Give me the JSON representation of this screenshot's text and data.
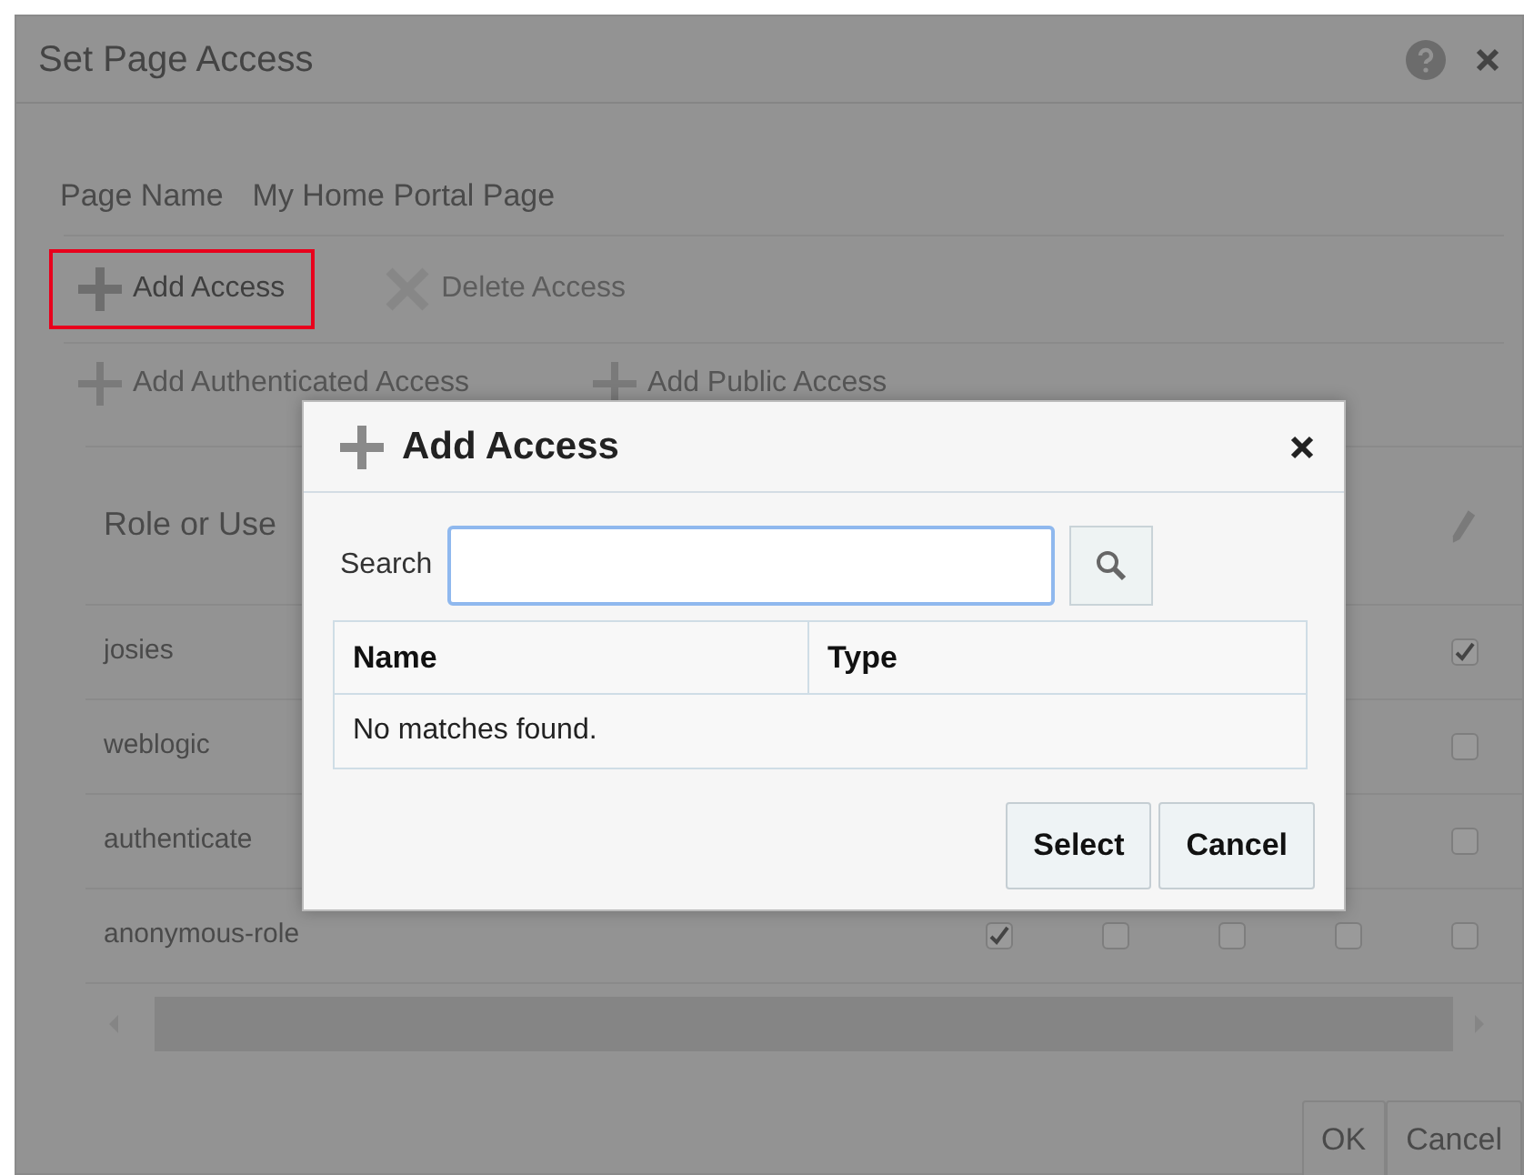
{
  "window": {
    "title": "Set Page Access"
  },
  "page_name": {
    "label": "Page Name",
    "value": "My Home Portal Page"
  },
  "toolbar": [
    {
      "label": "Add Access",
      "kind": "add",
      "disabled": false,
      "highlighted": true
    },
    {
      "label": "Delete Access",
      "kind": "delete",
      "disabled": true,
      "highlighted": false
    }
  ],
  "toolbar_2": [
    {
      "label": "Add Authenticated Access",
      "disabled": true
    },
    {
      "label": "Add Public Access",
      "disabled": true
    }
  ],
  "table": {
    "column_1": "Role or Use",
    "rows": [
      {
        "name": "josies",
        "checks": [
          {
            "checked": true
          }
        ]
      },
      {
        "name": "weblogic",
        "checks": [
          {
            "checked": false
          }
        ]
      },
      {
        "name": "authenticate",
        "checks": [
          {
            "checked": false
          }
        ]
      },
      {
        "name": "anonymous-role",
        "checks": [
          {
            "checked": true
          },
          {
            "checked": false
          },
          {
            "checked": false
          },
          {
            "checked": false
          },
          {
            "checked": false
          }
        ]
      }
    ]
  },
  "buttons": [
    "OK",
    "Cancel"
  ],
  "dialog": {
    "title": "Add Access",
    "search_label": "Search",
    "columns": [
      "Name",
      "Type"
    ],
    "empty_text": "No matches found.",
    "buttons": [
      "Select",
      "Cancel"
    ]
  }
}
